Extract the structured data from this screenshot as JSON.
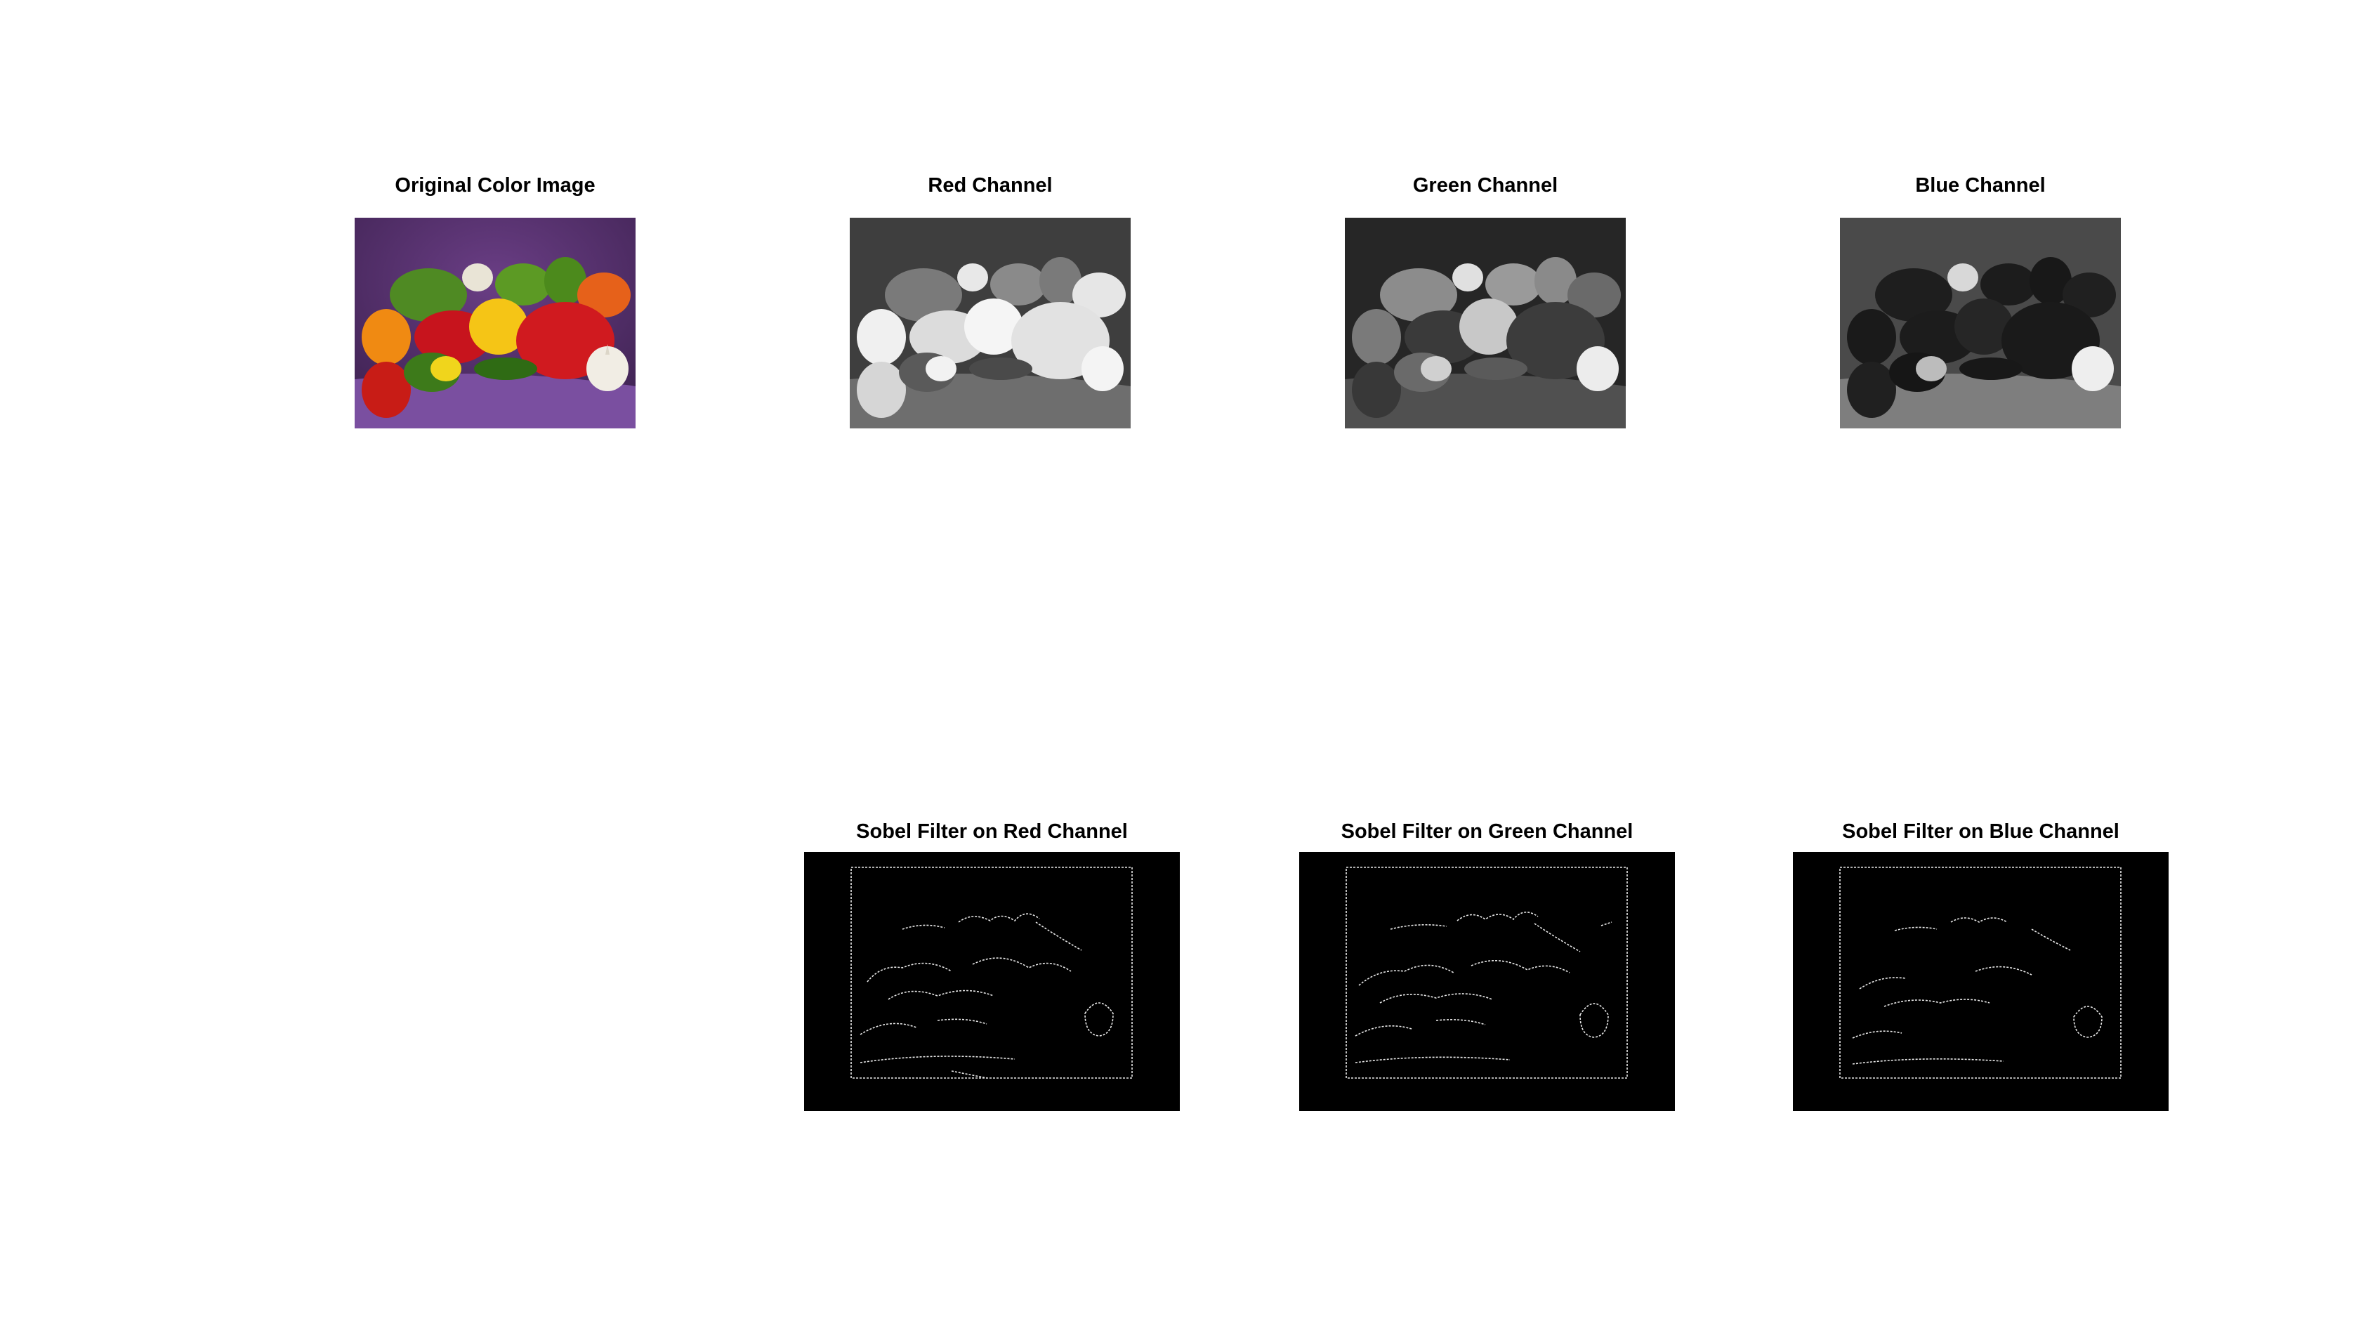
{
  "figure": {
    "background": "#ffffff",
    "panels": [
      {
        "id": "original",
        "title": "Original Color Image"
      },
      {
        "id": "red",
        "title": "Red Channel"
      },
      {
        "id": "green",
        "title": "Green Channel"
      },
      {
        "id": "blue",
        "title": "Blue Channel"
      },
      {
        "id": "sobel-red",
        "title": "Sobel Filter on Red Channel"
      },
      {
        "id": "sobel-green",
        "title": "Sobel Filter on Green Channel"
      },
      {
        "id": "sobel-blue",
        "title": "Sobel Filter on Blue Channel"
      }
    ]
  },
  "colors": {
    "purple_backdrop": "#5a3470",
    "edge_background": "#000000",
    "edge_lines": "#e8e8e8"
  }
}
